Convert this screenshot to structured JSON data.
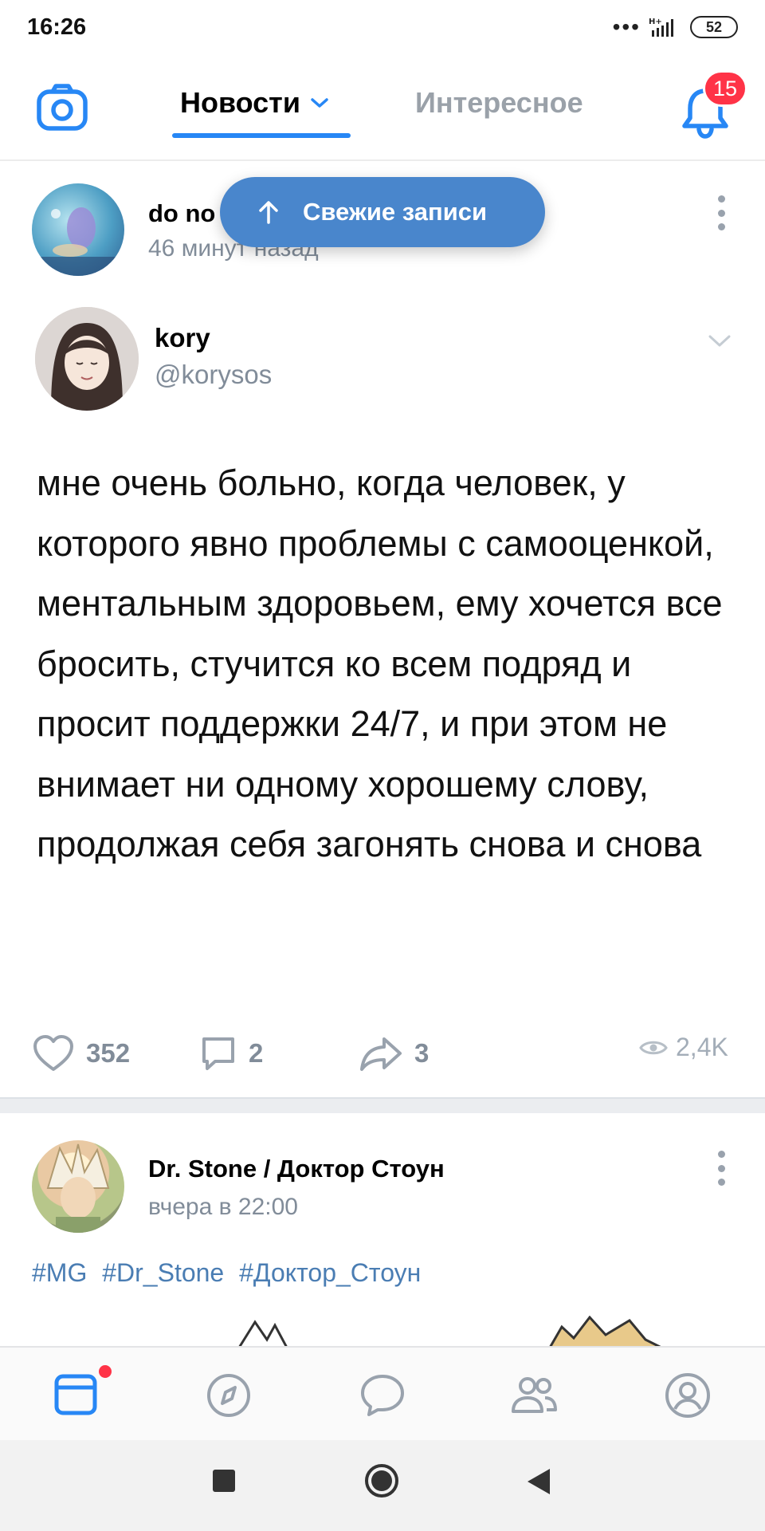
{
  "status_bar": {
    "time": "16:26",
    "dots": "•••",
    "network": "H+",
    "battery": "52"
  },
  "header": {
    "tab_news": "Новости",
    "tab_interesting": "Интересное",
    "notification_count": "15",
    "accent": "#2787f5"
  },
  "fresh_button": {
    "label": "Свежие записи"
  },
  "post1": {
    "author": "do no",
    "time": "46 минут назад",
    "quote": {
      "name": "kory",
      "handle": "@korysos",
      "text": "мне очень больно, когда человек, у которого явно проблемы с самооценкой, ментальным здоровьем, ему хочется все бросить, стучится ко всем подряд и просит поддержки 24/7, и при этом не внимает ни одному хорошему слову, продолжая себя загонять снова и снова"
    },
    "likes": "352",
    "comments": "2",
    "shares": "3",
    "views": "2,4K"
  },
  "post2": {
    "author": "Dr. Stone / Доктор Стоун",
    "time": "вчера в 22:00",
    "hashtags": [
      "#MG",
      "#Dr_Stone",
      "#Доктор_Стоун"
    ]
  },
  "bottom_nav": {
    "items": [
      "news",
      "discover",
      "messages",
      "friends",
      "profile"
    ]
  }
}
